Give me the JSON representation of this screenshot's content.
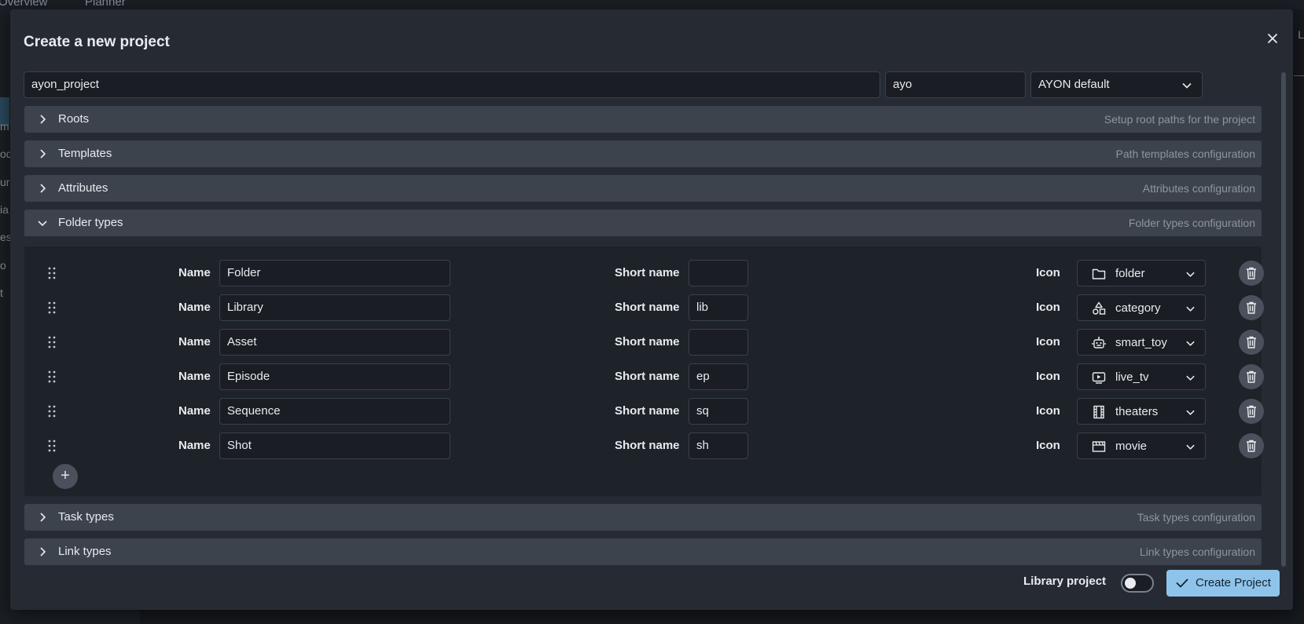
{
  "background": {
    "tabs": [
      "Overview",
      "Planner"
    ],
    "sidebar_fragments": [
      "m",
      "od",
      "ur",
      "ia",
      "es",
      "o",
      "t"
    ],
    "right_fragment": "L"
  },
  "dialog": {
    "title": "Create a new project",
    "project_name": "ayon_project",
    "project_code": "ayo",
    "anatomy_preset": "AYON default",
    "sections": {
      "roots": {
        "title": "Roots",
        "description": "Setup root paths for the project"
      },
      "templates": {
        "title": "Templates",
        "description": "Path templates configuration"
      },
      "attributes": {
        "title": "Attributes",
        "description": "Attributes configuration"
      },
      "folder_types": {
        "title": "Folder types",
        "description": "Folder types configuration"
      },
      "task_types": {
        "title": "Task types",
        "description": "Task types configuration"
      },
      "link_types": {
        "title": "Link types",
        "description": "Link types configuration"
      }
    },
    "field_labels": {
      "name": "Name",
      "short_name": "Short name",
      "icon": "Icon"
    },
    "folder_types": [
      {
        "name": "Folder",
        "short_name": "",
        "icon": "folder"
      },
      {
        "name": "Library",
        "short_name": "lib",
        "icon": "category"
      },
      {
        "name": "Asset",
        "short_name": "",
        "icon": "smart_toy"
      },
      {
        "name": "Episode",
        "short_name": "ep",
        "icon": "live_tv"
      },
      {
        "name": "Sequence",
        "short_name": "sq",
        "icon": "theaters"
      },
      {
        "name": "Shot",
        "short_name": "sh",
        "icon": "movie"
      }
    ],
    "footer": {
      "library_label": "Library project",
      "library_enabled": false,
      "create_label": "Create Project"
    }
  },
  "colors": {
    "dialog_bg": "#262b33",
    "section_bg": "#3c434d",
    "primary": "#8fc4ea"
  }
}
